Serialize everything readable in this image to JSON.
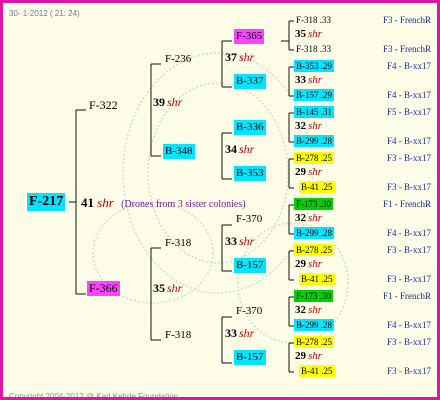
{
  "header": "30-  1-2012 ( 21: 24)",
  "footer": "Copyright 2004-2012 @ Karl Kehrle Foundation.",
  "colors": {
    "border": "#e0149e",
    "background": "#fefde8",
    "cyan": "#00e5ff",
    "magenta": "#ff44ff",
    "yellow": "#ffff00",
    "green": "#00d000",
    "shr": "#c80000",
    "right_label": "#1a2aa8",
    "drone_note": "#6a1fb0"
  },
  "root": {
    "id": "F-217",
    "num": "41",
    "suffix": "shr",
    "note": "(Drones from 3 sister colonies)"
  },
  "gen1": [
    {
      "id": "F-322",
      "num": "39",
      "suffix": "shr"
    },
    {
      "id": "F-366",
      "num": "35",
      "suffix": "shr"
    }
  ],
  "gen2": [
    {
      "id": "F-236",
      "num": "37",
      "suffix": "shr"
    },
    {
      "id": "B-348",
      "num": "34",
      "suffix": "shr"
    },
    {
      "id": "F-318",
      "num": "33",
      "suffix": "shr"
    },
    {
      "id": "F-318",
      "num": "33",
      "suffix": "shr"
    }
  ],
  "gen3": [
    {
      "id": "F-365",
      "num": "35",
      "suffix": "shr"
    },
    {
      "id": "B-337",
      "num": "33",
      "suffix": "shr"
    },
    {
      "id": "B-336",
      "num": "32",
      "suffix": "shr"
    },
    {
      "id": "B-353",
      "num": "29",
      "suffix": "shr"
    },
    {
      "id": "F-370",
      "num": "32",
      "suffix": "shr"
    },
    {
      "id": "B-157",
      "num": "29",
      "suffix": "shr"
    },
    {
      "id": "F-370",
      "num": "32",
      "suffix": "shr"
    },
    {
      "id": "B-157",
      "num": "29",
      "suffix": "shr"
    }
  ],
  "gen4": [
    {
      "id": "F-318 .33",
      "label": "F3 - FrenchR"
    },
    {
      "id": "F-318 .33",
      "label": "F3 - FrenchR"
    },
    {
      "id": "B-353 .29",
      "label": "F4 - B-xx17"
    },
    {
      "id": "B-157 .29",
      "label": "F4 - B-xx17"
    },
    {
      "id": "B-145 .31",
      "label": "F5 - B-xx17"
    },
    {
      "id": "B-299 .28",
      "label": "F4 - B-xx17"
    },
    {
      "id": "B-278 .25",
      "label": "F3 - B-xx17"
    },
    {
      "id": "B-41 .25",
      "label": "F3 - B-xx17"
    },
    {
      "id": "F-173 .30",
      "label": "F1 - FrenchR"
    },
    {
      "id": "B-299 .28",
      "label": "F4 - B-xx17"
    },
    {
      "id": "B-278 .25",
      "label": "F3 - B-xx17"
    },
    {
      "id": "B-41 .25",
      "label": "F3 - B-xx17"
    },
    {
      "id": "F-173 .30",
      "label": "F1 - FrenchR"
    },
    {
      "id": "B-299 .28",
      "label": "F4 - B-xx17"
    },
    {
      "id": "B-278 .25",
      "label": "F3 - B-xx17"
    },
    {
      "id": "B-41 .25",
      "label": "F3 - B-xx17"
    }
  ]
}
